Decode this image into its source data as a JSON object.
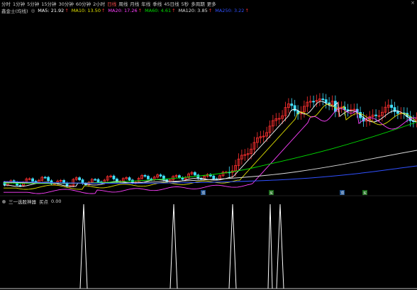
{
  "toolbar": {
    "periods": [
      "分时",
      "1分钟",
      "5分钟",
      "15分钟",
      "30分钟",
      "60分钟",
      "2小时",
      "日线",
      "周线",
      "月线",
      "年线",
      "季线",
      "45日线",
      "5秒",
      "多周期"
    ],
    "active_index": 7,
    "more_label": "更多",
    "close_glyph": "×"
  },
  "legend": {
    "title": "鑫金士(均线)",
    "ma_items": [
      {
        "text": "MA5: 21.92",
        "color": "#ffffff"
      },
      {
        "text": "MA10: 13.50",
        "color": "#e0e000"
      },
      {
        "text": "MA20: 17.26",
        "color": "#ff40ff"
      },
      {
        "text": "MA60: 4.61",
        "color": "#00dd00"
      },
      {
        "text": "MA120: 3.85",
        "color": "#dddddd"
      },
      {
        "text": "MA250: 3.22",
        "color": "#3050ff"
      }
    ]
  },
  "bottom_legend": {
    "label": "三一选股神器",
    "value_label": "买点",
    "value": "0.00"
  },
  "markers": [
    "顶",
    "买",
    "顶",
    "买"
  ],
  "colors": {
    "up": "#ff3030",
    "down": "#40e0ff",
    "ma5": "#ffffff",
    "ma10": "#e0e000",
    "ma20": "#ff40ff",
    "ma60": "#00dd00",
    "ma120": "#dddddd",
    "ma250": "#3050ff"
  }
}
